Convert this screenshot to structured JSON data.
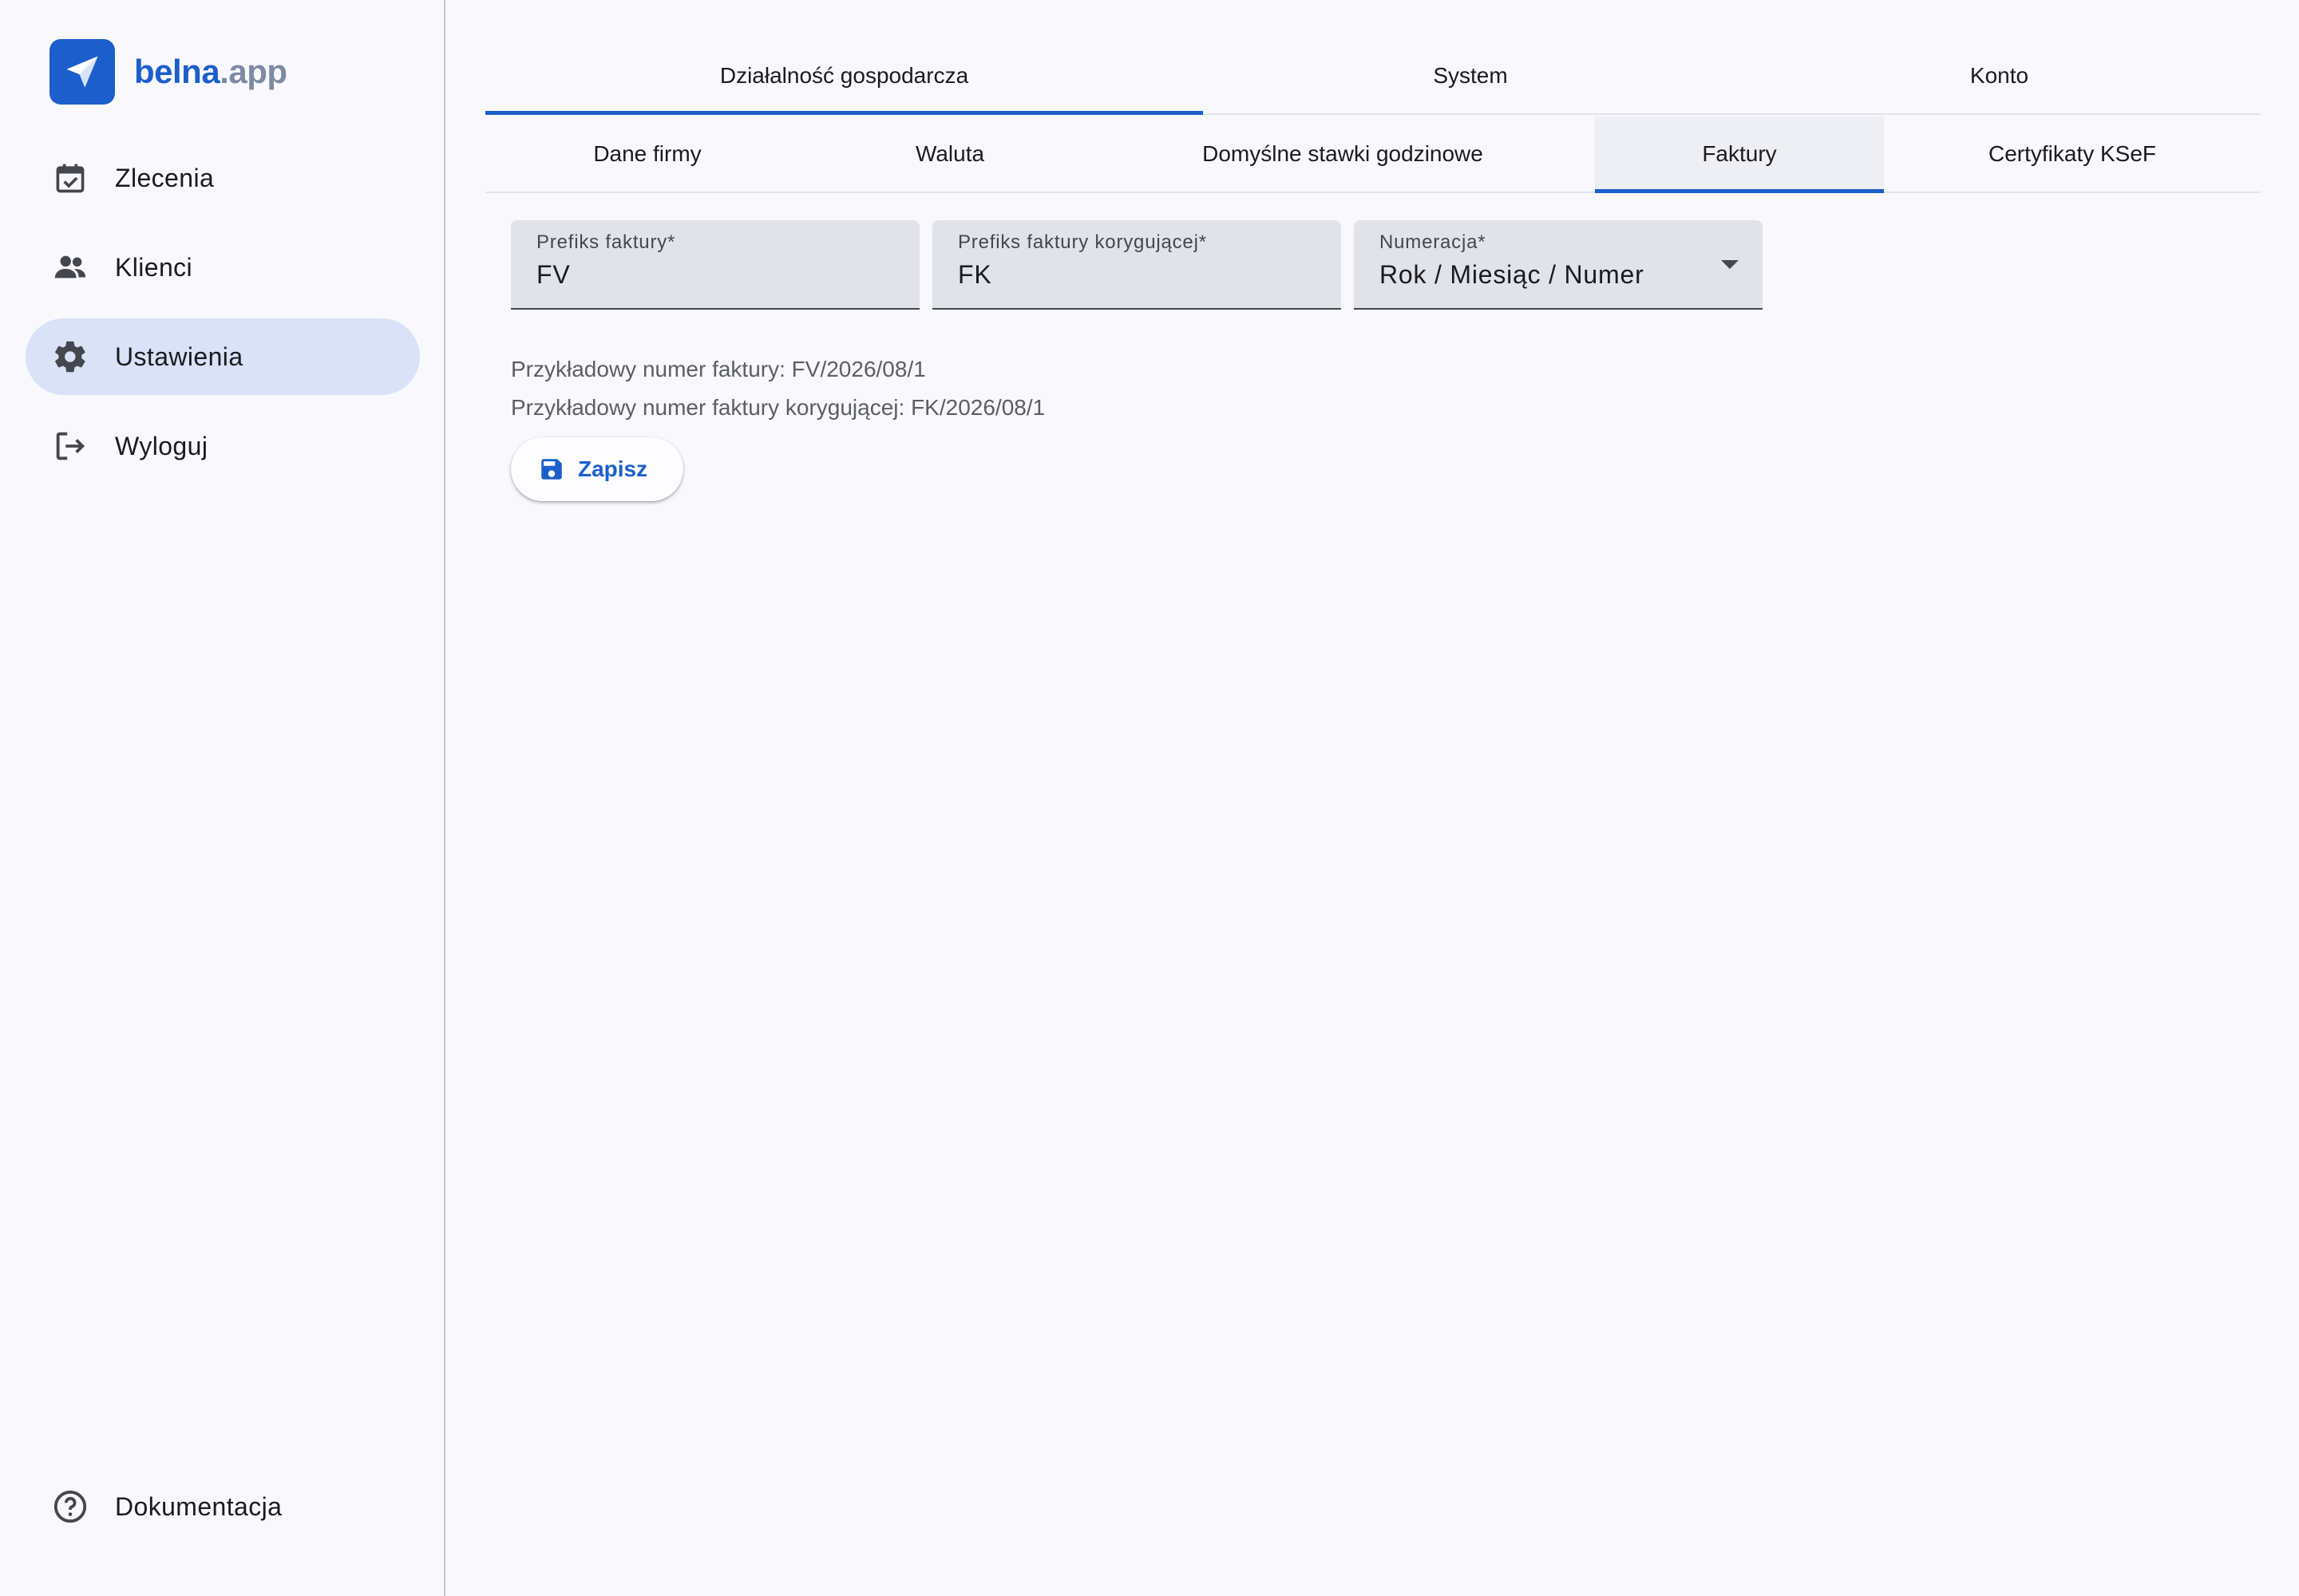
{
  "brand": {
    "name_primary": "belna",
    "name_secondary": ".app",
    "color": "#1c5fcc"
  },
  "sidebar": {
    "items": [
      {
        "label": "Zlecenia",
        "icon": "calendar-check-icon",
        "active": false
      },
      {
        "label": "Klienci",
        "icon": "people-icon",
        "active": false
      },
      {
        "label": "Ustawienia",
        "icon": "gear-icon",
        "active": true
      },
      {
        "label": "Wyloguj",
        "icon": "logout-icon",
        "active": false
      }
    ],
    "bottom_item": {
      "label": "Dokumentacja",
      "icon": "help-circle-icon"
    }
  },
  "tabs_primary": [
    {
      "label": "Działalność gospodarcza",
      "active": true
    },
    {
      "label": "System",
      "active": false
    },
    {
      "label": "Konto",
      "active": false
    }
  ],
  "tabs_secondary": [
    {
      "label": "Dane firmy",
      "active": false
    },
    {
      "label": "Waluta",
      "active": false
    },
    {
      "label": "Domyślne stawki godzinowe",
      "active": false
    },
    {
      "label": "Faktury",
      "active": true
    },
    {
      "label": "Certyfikaty KSeF",
      "active": false
    }
  ],
  "form": {
    "invoice_prefix": {
      "label": "Prefiks faktury*",
      "value": "FV"
    },
    "correction_prefix": {
      "label": "Prefiks faktury korygującej*",
      "value": "FK"
    },
    "numbering": {
      "label": "Numeracja*",
      "value": "Rok / Miesiąc / Numer"
    }
  },
  "hints": {
    "invoice_example": "Przykładowy numer faktury: FV/2026/08/1",
    "correction_example": "Przykładowy numer faktury korygującej: FK/2026/08/1"
  },
  "actions": {
    "save_label": "Zapisz"
  }
}
